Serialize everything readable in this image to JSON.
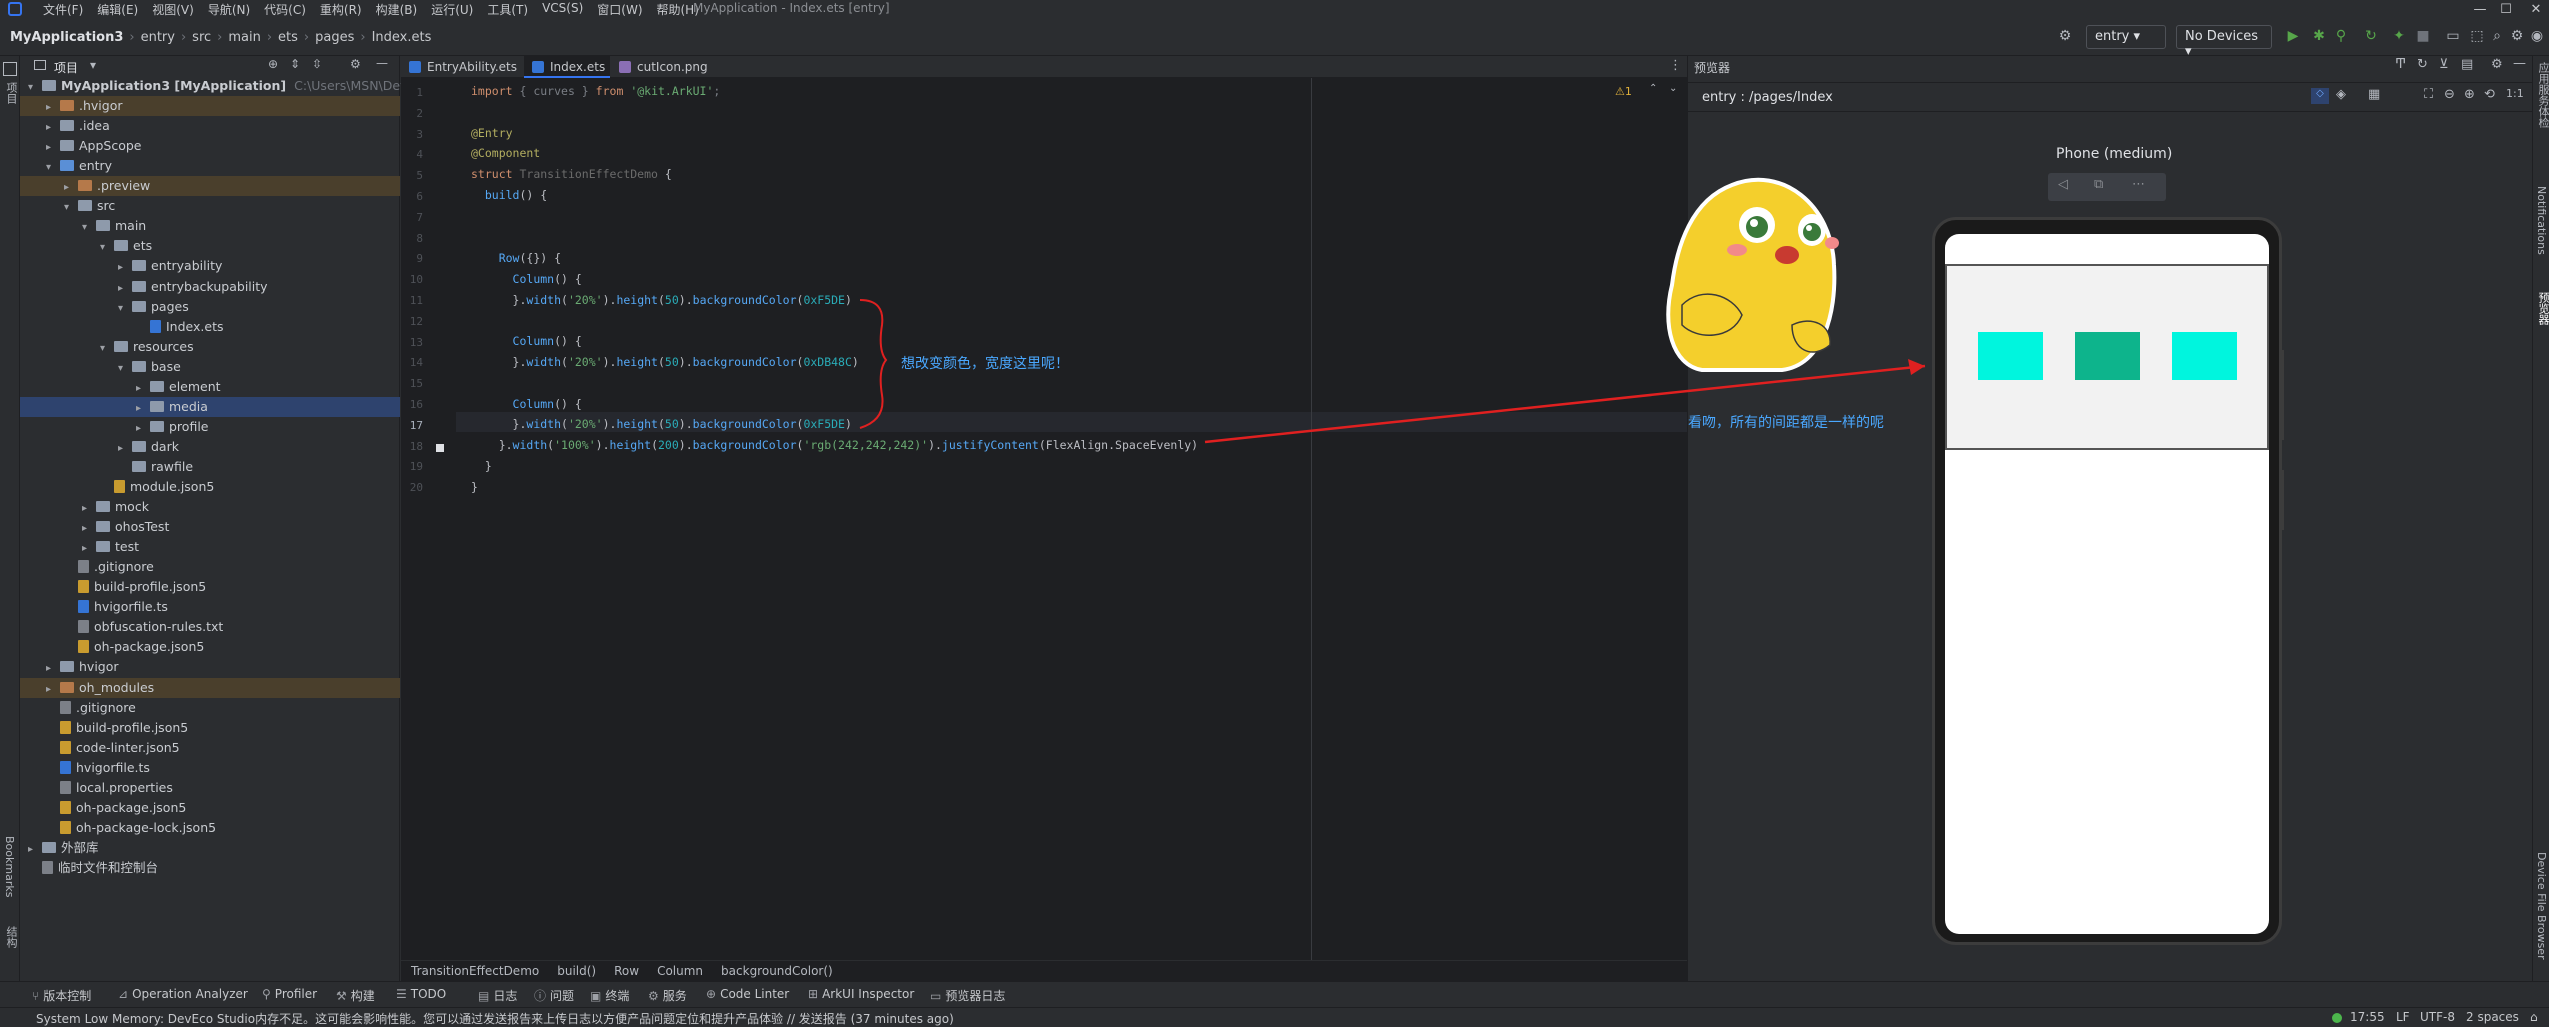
{
  "titlebar": {
    "menu": [
      "文件(F)",
      "编辑(E)",
      "视图(V)",
      "导航(N)",
      "代码(C)",
      "重构(R)",
      "构建(B)",
      "运行(U)",
      "工具(T)",
      "VCS(S)",
      "窗口(W)",
      "帮助(H)"
    ],
    "window_title": "MyApplication - Index.ets [entry]"
  },
  "navbar": {
    "crumbs": [
      "MyApplication3",
      "entry",
      "src",
      "main",
      "ets",
      "pages",
      "Index.ets"
    ],
    "module_select": "entry",
    "device_select": "No Devices"
  },
  "leftstrip": {
    "top_label": "项目",
    "bookmarks_label": "Bookmarks",
    "structure_label": "结构"
  },
  "project": {
    "header": "项目",
    "tree": [
      {
        "label": "MyApplication3 [MyApplication]",
        "extra": "C:\\Users\\MSN\\DevEco",
        "depth": 0,
        "arrow": "v",
        "kind": "folder",
        "hl": ""
      },
      {
        "label": ".hvigor",
        "depth": 1,
        "arrow": ">",
        "kind": "folder-orange",
        "hl": "orange"
      },
      {
        "label": ".idea",
        "depth": 1,
        "arrow": ">",
        "kind": "folder",
        "hl": ""
      },
      {
        "label": "AppScope",
        "depth": 1,
        "arrow": ">",
        "kind": "folder",
        "hl": ""
      },
      {
        "label": "entry",
        "depth": 1,
        "arrow": "v",
        "kind": "folder-blue",
        "hl": ""
      },
      {
        "label": ".preview",
        "depth": 2,
        "arrow": ">",
        "kind": "folder-orange",
        "hl": "orange"
      },
      {
        "label": "src",
        "depth": 2,
        "arrow": "v",
        "kind": "folder",
        "hl": ""
      },
      {
        "label": "main",
        "depth": 3,
        "arrow": "v",
        "kind": "folder",
        "hl": ""
      },
      {
        "label": "ets",
        "depth": 4,
        "arrow": "v",
        "kind": "folder",
        "hl": ""
      },
      {
        "label": "entryability",
        "depth": 5,
        "arrow": ">",
        "kind": "folder",
        "hl": ""
      },
      {
        "label": "entrybackupability",
        "depth": 5,
        "arrow": ">",
        "kind": "folder",
        "hl": ""
      },
      {
        "label": "pages",
        "depth": 5,
        "arrow": "v",
        "kind": "folder",
        "hl": ""
      },
      {
        "label": "Index.ets",
        "depth": 6,
        "arrow": "",
        "kind": "file-ts",
        "hl": ""
      },
      {
        "label": "resources",
        "depth": 4,
        "arrow": "v",
        "kind": "folder",
        "hl": ""
      },
      {
        "label": "base",
        "depth": 5,
        "arrow": "v",
        "kind": "folder",
        "hl": ""
      },
      {
        "label": "element",
        "depth": 6,
        "arrow": ">",
        "kind": "folder",
        "hl": ""
      },
      {
        "label": "media",
        "depth": 6,
        "arrow": ">",
        "kind": "folder",
        "hl": "blue"
      },
      {
        "label": "profile",
        "depth": 6,
        "arrow": ">",
        "kind": "folder",
        "hl": ""
      },
      {
        "label": "dark",
        "depth": 5,
        "arrow": ">",
        "kind": "folder",
        "hl": ""
      },
      {
        "label": "rawfile",
        "depth": 5,
        "arrow": "",
        "kind": "folder",
        "hl": ""
      },
      {
        "label": "module.json5",
        "depth": 4,
        "arrow": "",
        "kind": "file-json",
        "hl": ""
      },
      {
        "label": "mock",
        "depth": 3,
        "arrow": ">",
        "kind": "folder",
        "hl": ""
      },
      {
        "label": "ohosTest",
        "depth": 3,
        "arrow": ">",
        "kind": "folder",
        "hl": ""
      },
      {
        "label": "test",
        "depth": 3,
        "arrow": ">",
        "kind": "folder",
        "hl": ""
      },
      {
        "label": ".gitignore",
        "depth": 2,
        "arrow": "",
        "kind": "file-txt",
        "hl": ""
      },
      {
        "label": "build-profile.json5",
        "depth": 2,
        "arrow": "",
        "kind": "file-json",
        "hl": ""
      },
      {
        "label": "hvigorfile.ts",
        "depth": 2,
        "arrow": "",
        "kind": "file-ts",
        "hl": ""
      },
      {
        "label": "obfuscation-rules.txt",
        "depth": 2,
        "arrow": "",
        "kind": "file-txt",
        "hl": ""
      },
      {
        "label": "oh-package.json5",
        "depth": 2,
        "arrow": "",
        "kind": "file-json",
        "hl": ""
      },
      {
        "label": "hvigor",
        "depth": 1,
        "arrow": ">",
        "kind": "folder",
        "hl": ""
      },
      {
        "label": "oh_modules",
        "depth": 1,
        "arrow": ">",
        "kind": "folder-orange",
        "hl": "orange"
      },
      {
        "label": ".gitignore",
        "depth": 1,
        "arrow": "",
        "kind": "file-txt",
        "hl": ""
      },
      {
        "label": "build-profile.json5",
        "depth": 1,
        "arrow": "",
        "kind": "file-json",
        "hl": ""
      },
      {
        "label": "code-linter.json5",
        "depth": 1,
        "arrow": "",
        "kind": "file-json",
        "hl": ""
      },
      {
        "label": "hvigorfile.ts",
        "depth": 1,
        "arrow": "",
        "kind": "file-ts",
        "hl": ""
      },
      {
        "label": "local.properties",
        "depth": 1,
        "arrow": "",
        "kind": "file-txt",
        "hl": ""
      },
      {
        "label": "oh-package.json5",
        "depth": 1,
        "arrow": "",
        "kind": "file-json",
        "hl": ""
      },
      {
        "label": "oh-package-lock.json5",
        "depth": 1,
        "arrow": "",
        "kind": "file-json",
        "hl": ""
      },
      {
        "label": "外部库",
        "depth": 0,
        "arrow": ">",
        "kind": "folder",
        "hl": ""
      },
      {
        "label": "临时文件和控制台",
        "depth": 0,
        "arrow": "",
        "kind": "file-txt",
        "hl": ""
      }
    ]
  },
  "editor": {
    "tabs": [
      "EntryAbility.ets",
      "Index.ets",
      "cutIcon.png"
    ],
    "active_tab": 1,
    "warning_count": "⚠1",
    "line_numbers": [
      "1",
      "2",
      "3",
      "4",
      "5",
      "6",
      "7",
      "8",
      "9",
      "10",
      "11",
      "12",
      "13",
      "14",
      "15",
      "16",
      "17",
      "18",
      "19",
      "20"
    ],
    "annotation": "想改变颜色，宽度这里呢！",
    "breadcrumb": [
      "TransitionEffectDemo",
      "build()",
      "Row",
      "Column",
      "backgroundColor()"
    ]
  },
  "preview": {
    "panel_title": "预览器",
    "route": "entry : /pages/Index",
    "device_name": "Phone (medium)",
    "annotation": "看吻，所有的间距都是一样的呢",
    "column_colors": [
      "#0xF5DE",
      "#0xDB48C",
      "#0xF5DE"
    ]
  },
  "rightstrip": {
    "labels": [
      "应用服务体检",
      "Notifications",
      "预览器",
      "Device File Browser"
    ]
  },
  "bottombar": {
    "tools": [
      "版本控制",
      "Operation Analyzer",
      "Profiler",
      "构建",
      "TODO",
      "日志",
      "问题",
      "终端",
      "服务",
      "Code Linter",
      "ArkUI Inspector",
      "预览器日志"
    ]
  },
  "statusbar": {
    "message": "System Low Memory: DevEco Studio内存不足。这可能会影响性能。您可以通过发送报告来上传日志以方便产品问题定位和提升产品体验 // 发送报告 (37 minutes ago)",
    "position": "17:55",
    "line_sep": "LF",
    "encoding": "UTF-8",
    "indent": "2 spaces"
  }
}
